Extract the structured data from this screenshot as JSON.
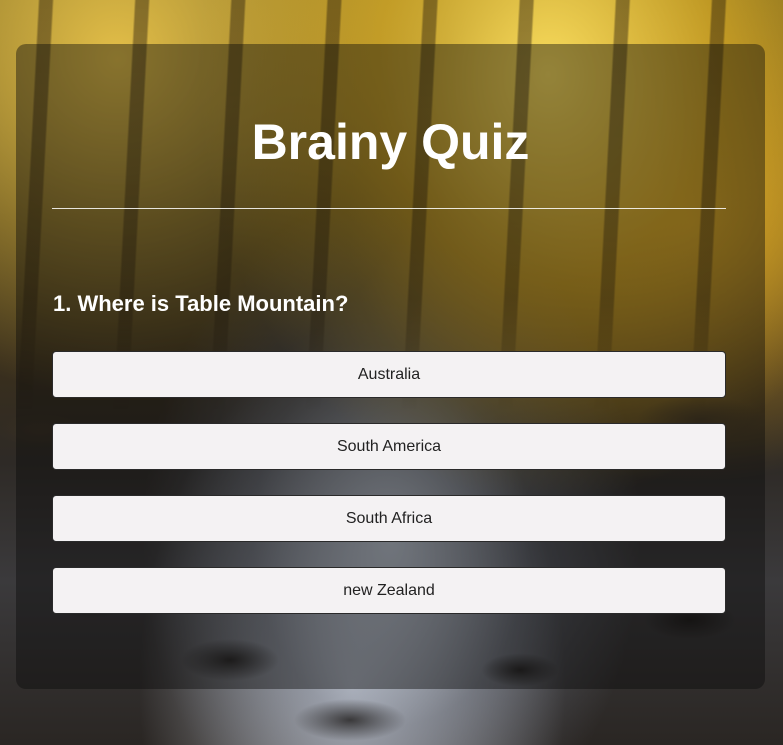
{
  "app": {
    "title": "Brainy Quiz"
  },
  "question": {
    "text": "1. Where is Table Mountain?"
  },
  "answers": [
    {
      "label": "Australia"
    },
    {
      "label": "South America"
    },
    {
      "label": "South Africa"
    },
    {
      "label": "new Zealand"
    }
  ],
  "colors": {
    "panel_overlay": "#0a0a0a",
    "title_text": "#ffffff",
    "button_bg": "#f4f2f3",
    "button_text": "#222222",
    "button_border": "#2a2a2a"
  }
}
